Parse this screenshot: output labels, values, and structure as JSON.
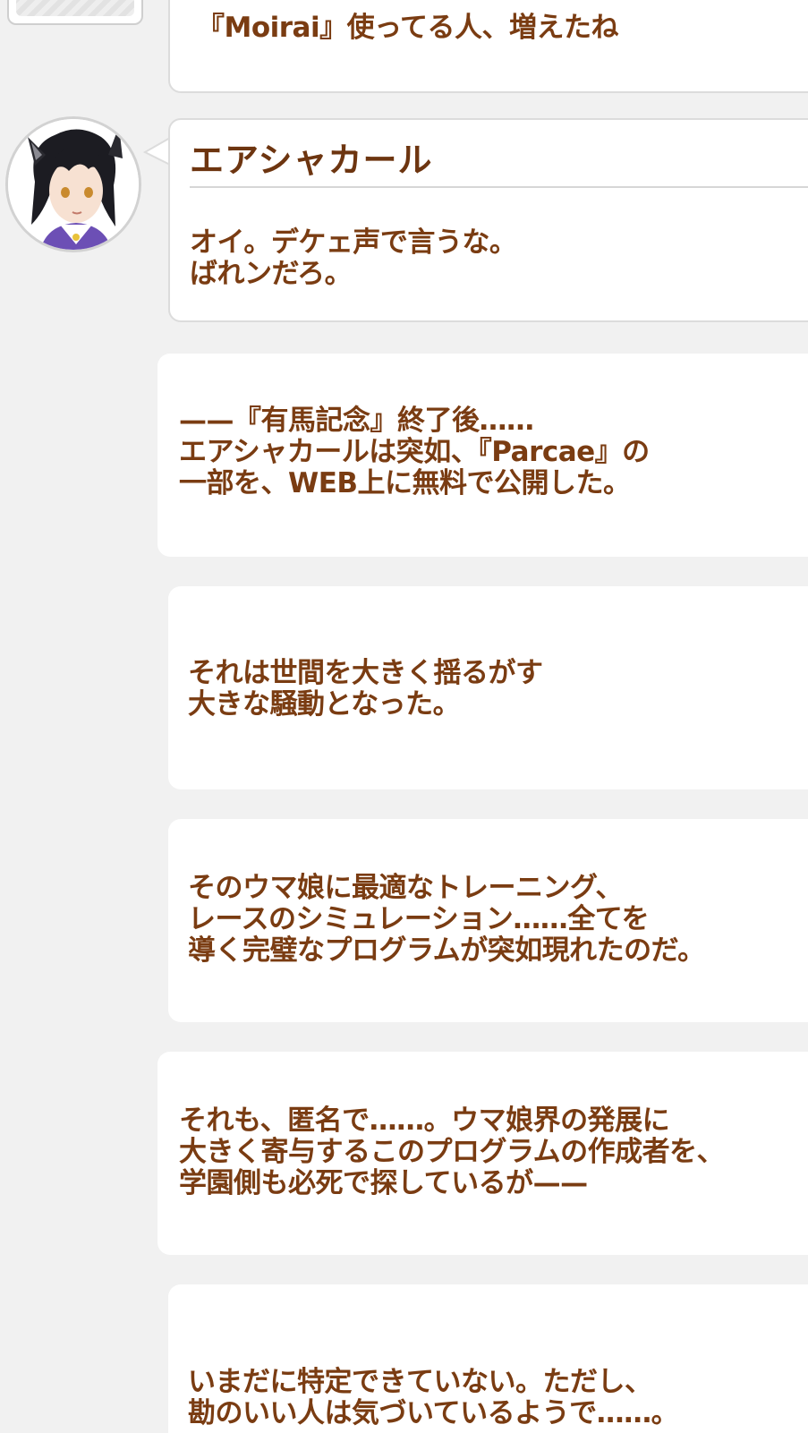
{
  "previous_message": "『Moirai』使ってる人、増えたね",
  "dialog": {
    "speaker": "エアシャカール",
    "text": "オイ。デケェ声で言うな。\nばれンだろ。"
  },
  "narration": [
    "——『有馬記念』終了後……\nエアシャカールは突如、『Parcae』の\n一部を、WEB上に無料で公開した。",
    "それは世間を大きく揺るがす\n大きな騒動となった。",
    "そのウマ娘に最適なトレーニング、\nレースのシミュレーション……全てを\n導く完璧なプログラムが突如現れたのだ。",
    "それも、匿名で……。ウマ娘界の発展に\n大きく寄与するこのプログラムの作成者を、\n学園側も必死で探しているが——",
    "いまだに特定できていない。ただし、\n勘のいい人は気づいているようで……。"
  ],
  "colors": {
    "background": "#f1f1f1",
    "card": "#ffffff",
    "text": "#7a3c12",
    "border": "#dcdcdc"
  },
  "icons": {
    "avatar": "character-avatar-air-shakur",
    "previous": "previous-avatar-frame"
  }
}
